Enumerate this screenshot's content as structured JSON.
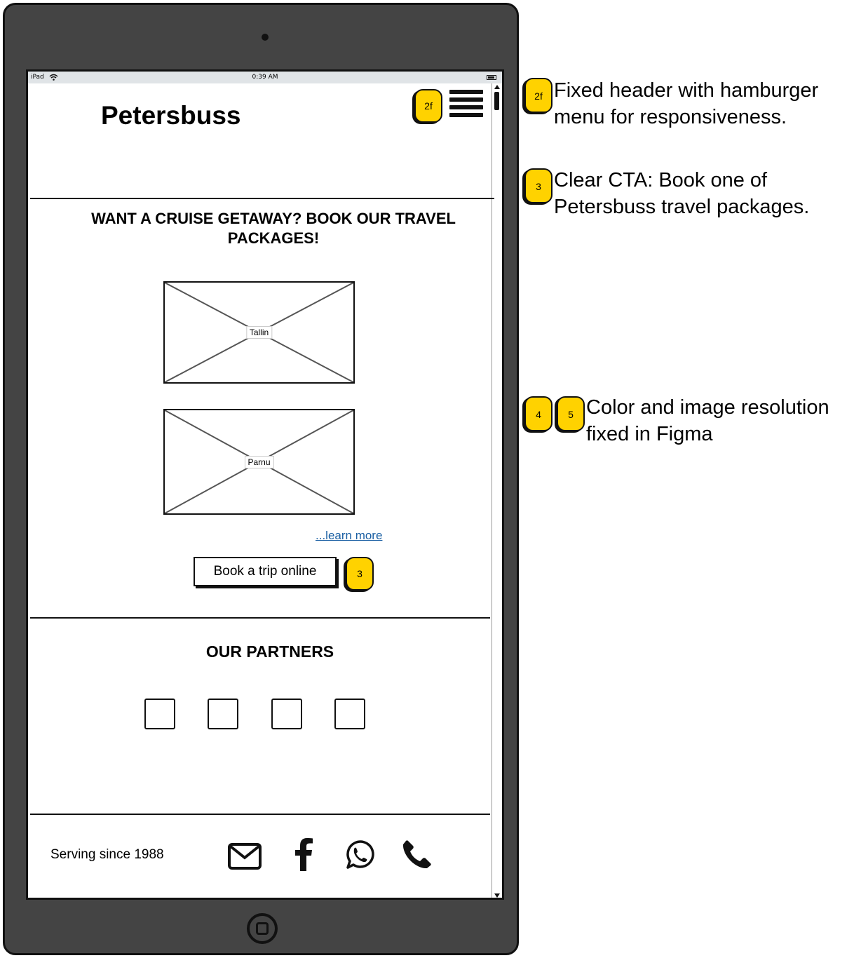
{
  "statusbar": {
    "carrier": "iPad",
    "time": "0:39 AM"
  },
  "header": {
    "logo": "Petersbuss",
    "badge": "2f"
  },
  "hero": {
    "heading": "WANT A CRUISE GETAWAY? BOOK OUR TRAVEL PACKAGES!",
    "images": [
      {
        "label": "Tallin"
      },
      {
        "label": "Parnu"
      }
    ],
    "learn_more": "...learn more",
    "cta_label": "Book a trip online",
    "cta_badge": "3"
  },
  "partners": {
    "title": "OUR PARTNERS",
    "count": 4
  },
  "footer": {
    "tagline": "Serving since 1988",
    "icons": [
      "envelope-icon",
      "facebook-icon",
      "whatsapp-icon",
      "phone-icon"
    ]
  },
  "annotations": [
    {
      "badges": [
        "2f"
      ],
      "text": "Fixed header with hamburger menu for responsiveness."
    },
    {
      "badges": [
        "3"
      ],
      "text": "Clear CTA: Book one of Petersbuss travel packages."
    },
    {
      "badges": [
        "4",
        "5"
      ],
      "text": "Color and image resolution fixed in Figma"
    }
  ],
  "colors": {
    "badge": "#ffd200",
    "device": "#444444",
    "link": "#1a5fa3",
    "statusbar": "#e0e4e7"
  }
}
